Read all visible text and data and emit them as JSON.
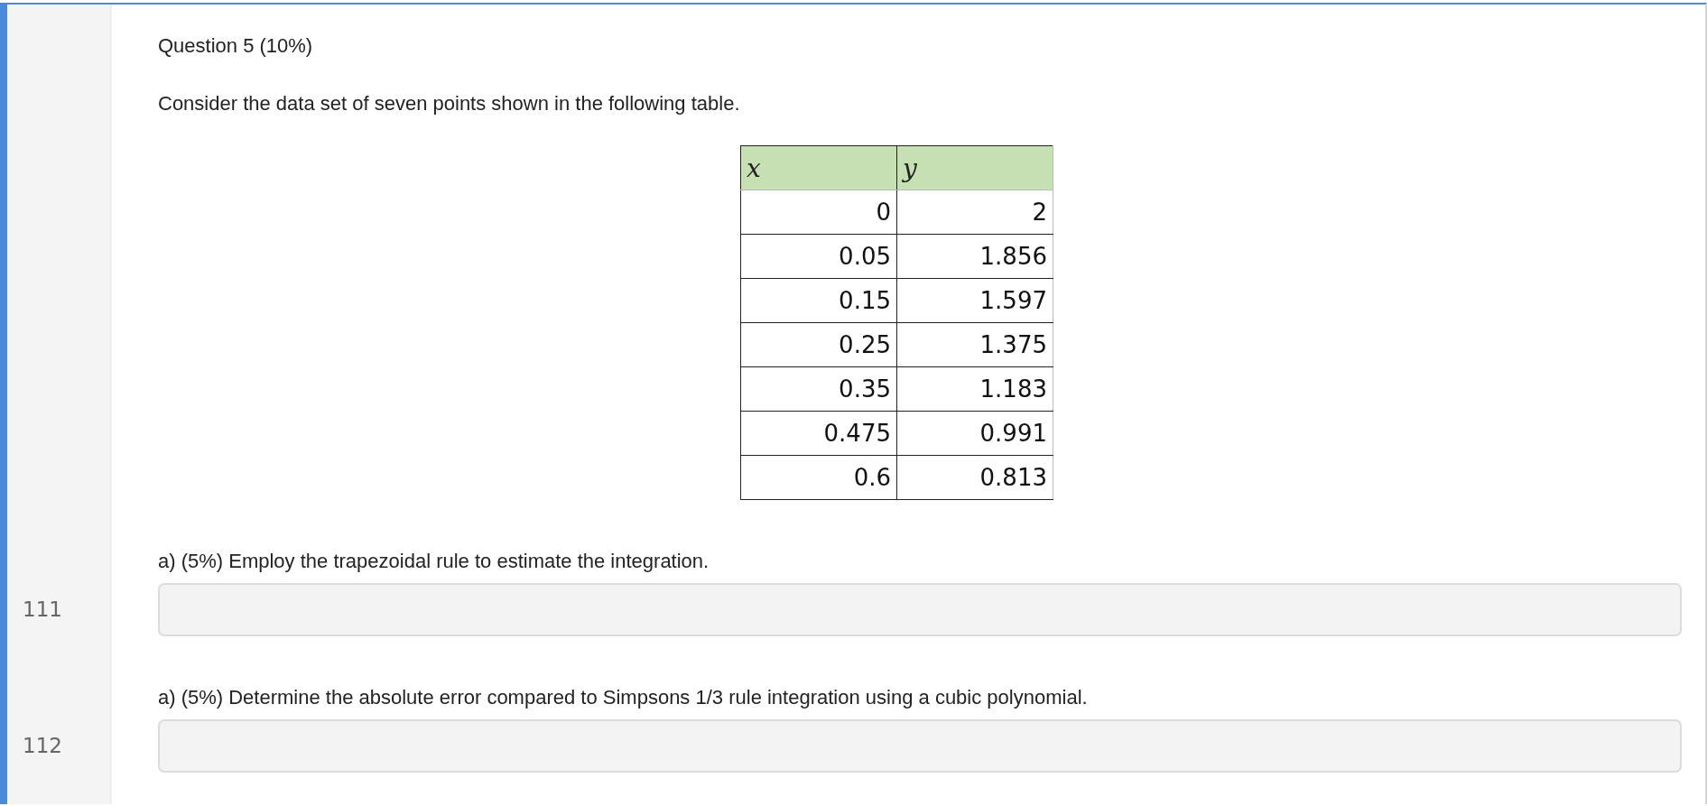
{
  "question": {
    "title": "Question 5 (10%)",
    "intro": "Consider the data set of seven points shown in the following table."
  },
  "table": {
    "columns": [
      "x",
      "y"
    ],
    "rows": [
      [
        "0",
        "2"
      ],
      [
        "0.05",
        "1.856"
      ],
      [
        "0.15",
        "1.597"
      ],
      [
        "0.25",
        "1.375"
      ],
      [
        "0.35",
        "1.183"
      ],
      [
        "0.475",
        "0.991"
      ],
      [
        "0.6",
        "0.813"
      ]
    ]
  },
  "parts": [
    {
      "prompt": "a) (5%) Employ the trapezoidal rule to estimate the integration.",
      "line_number": "111"
    },
    {
      "prompt": "a) (5%) Determine the absolute error compared to Simpsons 1/3 rule integration using a cubic polynomial.",
      "line_number": "112"
    }
  ]
}
